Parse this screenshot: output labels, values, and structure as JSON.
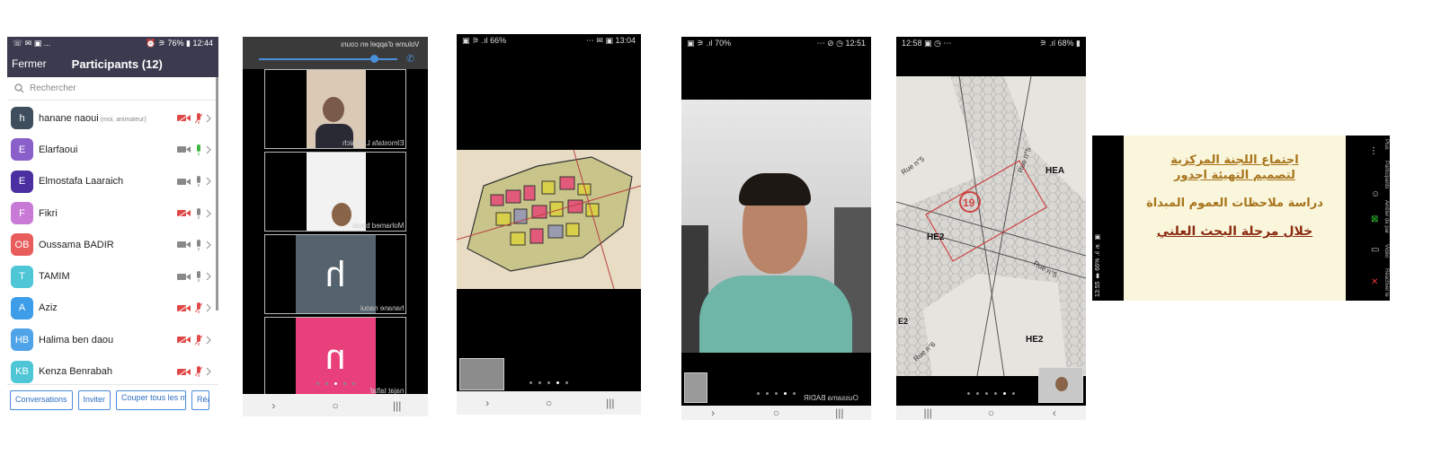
{
  "phone1": {
    "status_left": "☏ ✉ ▣ ...",
    "status_right": "⏰ ⚞ 76% ▮ 12:44",
    "close_label": "Fermer",
    "title": "Participants (12)",
    "search_placeholder": "Rechercher",
    "participants": [
      {
        "initials": "h",
        "name": "hanane naoui",
        "role": "(moi, animateur)",
        "color": "#3f4e5c",
        "cam_off": true,
        "mic_state": "muted"
      },
      {
        "initials": "E",
        "name": "Elarfaoui",
        "role": "",
        "color": "#8a5fc9",
        "cam_off": false,
        "mic_state": "active"
      },
      {
        "initials": "E",
        "name": "Elmostafa Laaraich",
        "role": "",
        "color": "#4b2fa0",
        "cam_off": false,
        "mic_state": "idle"
      },
      {
        "initials": "F",
        "name": "Fikri",
        "role": "",
        "color": "#c87ad6",
        "cam_off": true,
        "mic_state": "idle"
      },
      {
        "initials": "OB",
        "name": "Oussama BADIR",
        "role": "",
        "color": "#e85c5c",
        "cam_off": false,
        "mic_state": "idle"
      },
      {
        "initials": "T",
        "name": "TAMIM",
        "role": "",
        "color": "#4fc6d6",
        "cam_off": false,
        "mic_state": "idle"
      },
      {
        "initials": "A",
        "name": "Aziz",
        "role": "",
        "color": "#3e9de8",
        "cam_off": true,
        "mic_state": "muted"
      },
      {
        "initials": "HB",
        "name": "Halima ben daou",
        "role": "",
        "color": "#4fa3e8",
        "cam_off": true,
        "mic_state": "muted"
      },
      {
        "initials": "KB",
        "name": "Kenza Benrabah",
        "role": "",
        "color": "#4fc6d6",
        "cam_off": true,
        "mic_state": "muted"
      }
    ],
    "buttons": [
      "Conversations",
      "Inviter",
      "Couper tous les micros",
      "Réa"
    ]
  },
  "phone2": {
    "volume_label": "Volume d'appel en cours",
    "tiles": [
      {
        "label": "Elmostafa Laaraich"
      },
      {
        "label": "Mohamed boulo"
      },
      {
        "label": "hanane naoui",
        "letter": "h",
        "bg": "#55636e"
      },
      {
        "label": "najat taftaf",
        "letter": "n",
        "bg": "#e8407a"
      }
    ]
  },
  "phone3": {
    "status_left": "▣ ⚞ .ıl 66%",
    "status_right": "⋯ ✉ ▣ 13:04"
  },
  "phone4": {
    "status_left": "▣ ⚞ .ıl 70%",
    "status_right": "⋯ ⊘ ◷ 12:51",
    "name_label": "Oussama BADIR"
  },
  "phone5": {
    "status_left": "12:58 ▣ ◷ ⋯",
    "status_right": "⚞ .ıl 68% ▮",
    "map_labels": [
      "HEA",
      "HE2",
      "HE2",
      "E2",
      "Rue n°5",
      "Rue n°5",
      "Rue n°5",
      "Rue n°6",
      "19"
    ]
  },
  "phone6": {
    "status_text": "13:55 ▮ 66% .ıl ⚞ ▣",
    "slide_lines": [
      "اجتماع اللجنة المركزية",
      "لتصميم التهيئة اجدور",
      "دراسة ملاحظات العموم المبداة",
      "خلال مرحلة البحث العلني"
    ],
    "side_labels": [
      "Plus",
      "Participants",
      "Arrêter de par",
      "Vidéo",
      "Réactiver le"
    ]
  }
}
